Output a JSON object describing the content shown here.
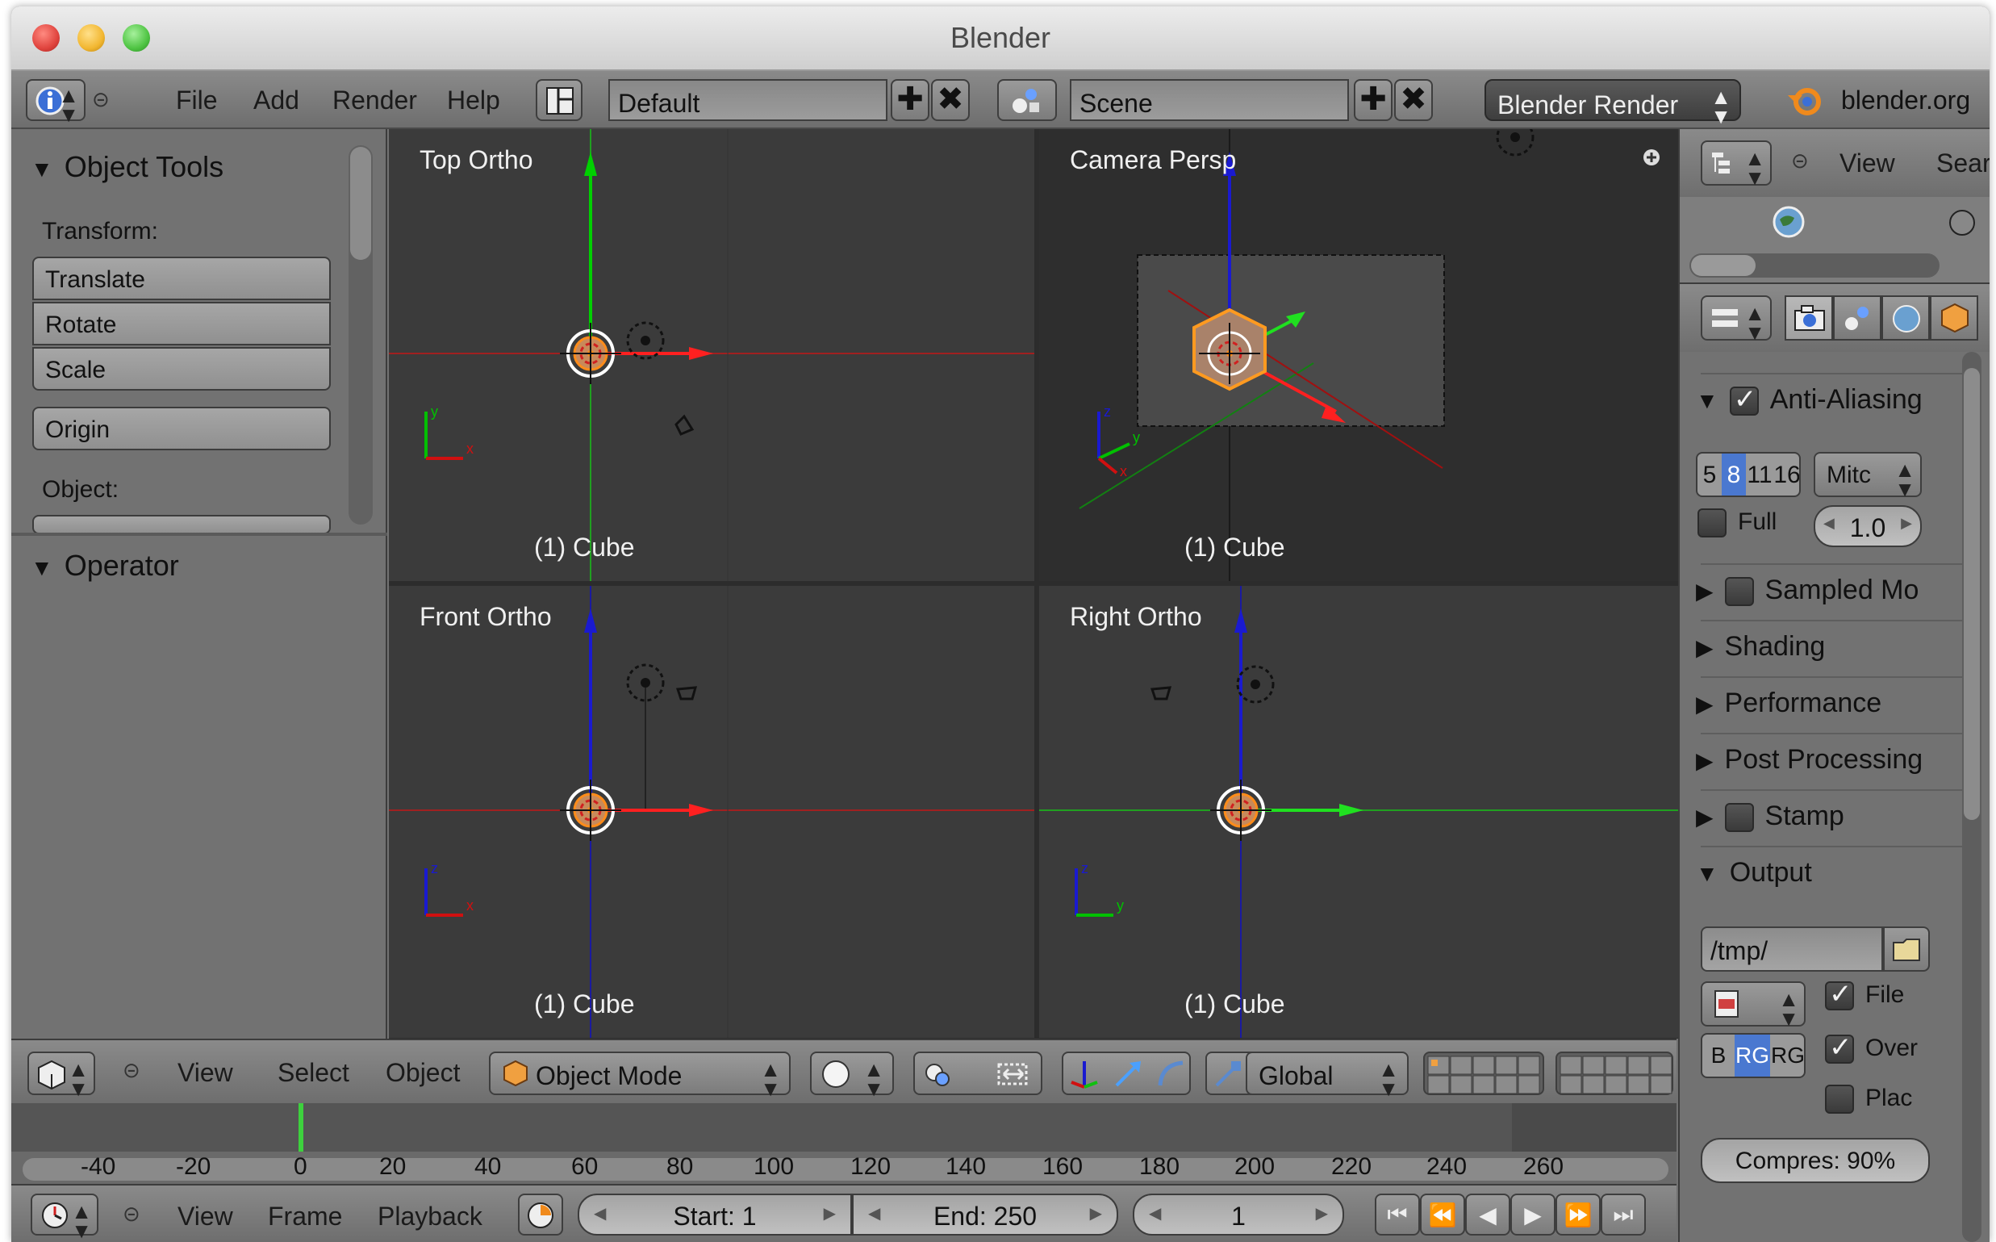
{
  "window": {
    "title": "Blender"
  },
  "info_header": {
    "menus": [
      "File",
      "Add",
      "Render",
      "Help"
    ],
    "screen_layout": "Default",
    "scene": "Scene",
    "render_engine": "Blender Render",
    "website": "blender.org"
  },
  "tool_shelf": {
    "object_tools_title": "Object Tools",
    "transform_label": "Transform:",
    "buttons": {
      "translate": "Translate",
      "rotate": "Rotate",
      "scale": "Scale",
      "origin": "Origin"
    },
    "object_label": "Object:",
    "operator_title": "Operator"
  },
  "viewports": [
    {
      "title": "Top Ortho",
      "object": "(1) Cube"
    },
    {
      "title": "Camera Persp",
      "object": "(1) Cube"
    },
    {
      "title": "Front Ortho",
      "object": "(1) Cube"
    },
    {
      "title": "Right Ortho",
      "object": "(1) Cube"
    }
  ],
  "view3d_header": {
    "menus": [
      "View",
      "Select",
      "Object"
    ],
    "mode": "Object Mode",
    "orientation": "Global"
  },
  "timeline": {
    "ruler": [
      "-40",
      "-20",
      "0",
      "20",
      "40",
      "60",
      "80",
      "100",
      "120",
      "140",
      "160",
      "180",
      "200",
      "220",
      "240",
      "260"
    ],
    "current_frame_position": 0
  },
  "timeline_header": {
    "menus": [
      "View",
      "Frame",
      "Playback"
    ],
    "start": "Start: 1",
    "end": "End: 250",
    "current": "1"
  },
  "outliner_header": {
    "view": "View",
    "search": "Sear"
  },
  "properties": {
    "anti_aliasing": "Anti-Aliasing",
    "aa_samples": [
      "5",
      "8",
      "11",
      "16"
    ],
    "filter": "Mitc",
    "full_sample": "Full",
    "filter_size": "1.0",
    "sampled_motion": "Sampled Mo",
    "shading": "Shading",
    "performance": "Performance",
    "post_processing": "Post Processing",
    "stamp": "Stamp",
    "output": "Output",
    "output_path": "/tmp/",
    "file_ext": "File",
    "overwrite": "Over",
    "placeholders": "Plac",
    "color_modes": [
      "B",
      "RG",
      "RG"
    ],
    "compression": "Compres: 90%"
  }
}
